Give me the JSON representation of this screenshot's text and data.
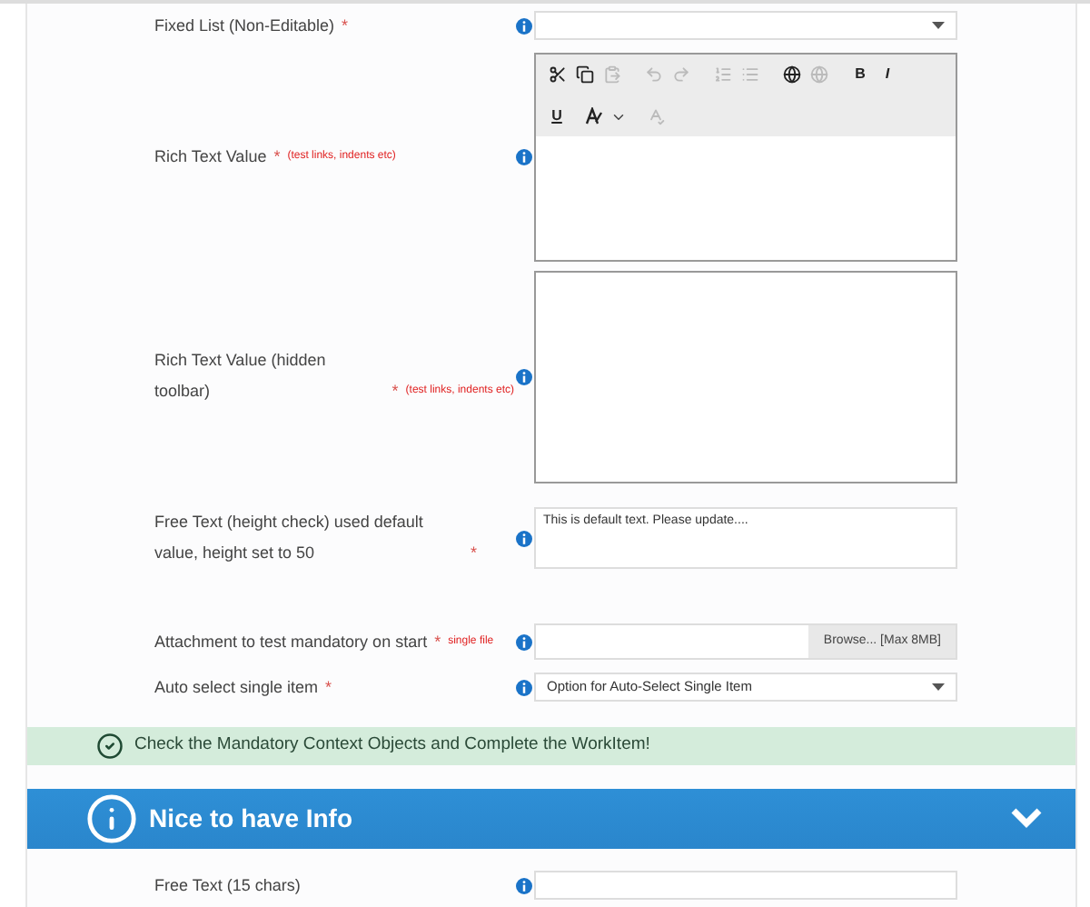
{
  "fields": [
    {
      "kind": "select",
      "label": "Fixed List (Non-Editable)",
      "required": true,
      "required_mark": "*"
    },
    {
      "kind": "rich_text",
      "label": "Rich Text Value",
      "required": true,
      "required_mark": "*",
      "note": "(test links, indents etc)",
      "toolbar": [
        {
          "kind": "cut",
          "disabled": false
        },
        {
          "kind": "copy",
          "disabled": false
        },
        {
          "kind": "paste",
          "disabled": true
        },
        {
          "kind": "undo",
          "disabled": true
        },
        {
          "kind": "redo",
          "disabled": true
        },
        {
          "kind": "numbered-list",
          "disabled": true
        },
        {
          "kind": "bullet-list",
          "disabled": true
        },
        {
          "kind": "link",
          "disabled": false
        },
        {
          "kind": "unlink",
          "disabled": true
        },
        {
          "kind": "bold",
          "disabled": false,
          "text": "B"
        },
        {
          "kind": "italic",
          "disabled": false,
          "text": "I"
        },
        {
          "kind": "underline",
          "disabled": false,
          "text": "U"
        },
        {
          "kind": "spell",
          "disabled": false
        },
        {
          "kind": "spell-check",
          "disabled": true
        }
      ]
    },
    {
      "kind": "rich_text_plain",
      "label": "Rich Text Value (hidden toolbar)",
      "required": true,
      "required_mark": "*",
      "note": "(test links, indents etc)"
    },
    {
      "kind": "textarea",
      "label": "Free Text (height check) used default value, height set to 50",
      "required": true,
      "required_mark": "*",
      "value": "This is default text. Please update...."
    },
    {
      "kind": "file",
      "label": "Attachment to test mandatory on start",
      "required": true,
      "required_mark": "*",
      "note": "single file",
      "button": "Browse... [Max 8MB]"
    },
    {
      "kind": "select",
      "label": "Auto select single item",
      "required": true,
      "required_mark": "*",
      "value": "Option for Auto-Select Single Item"
    }
  ],
  "banner": {
    "text": "Check the Mandatory Context Objects and Complete the WorkItem!"
  },
  "section": {
    "title": "Nice to have Info",
    "expanded": true,
    "fields": [
      {
        "kind": "text",
        "label": "Free Text (15 chars)"
      }
    ]
  }
}
